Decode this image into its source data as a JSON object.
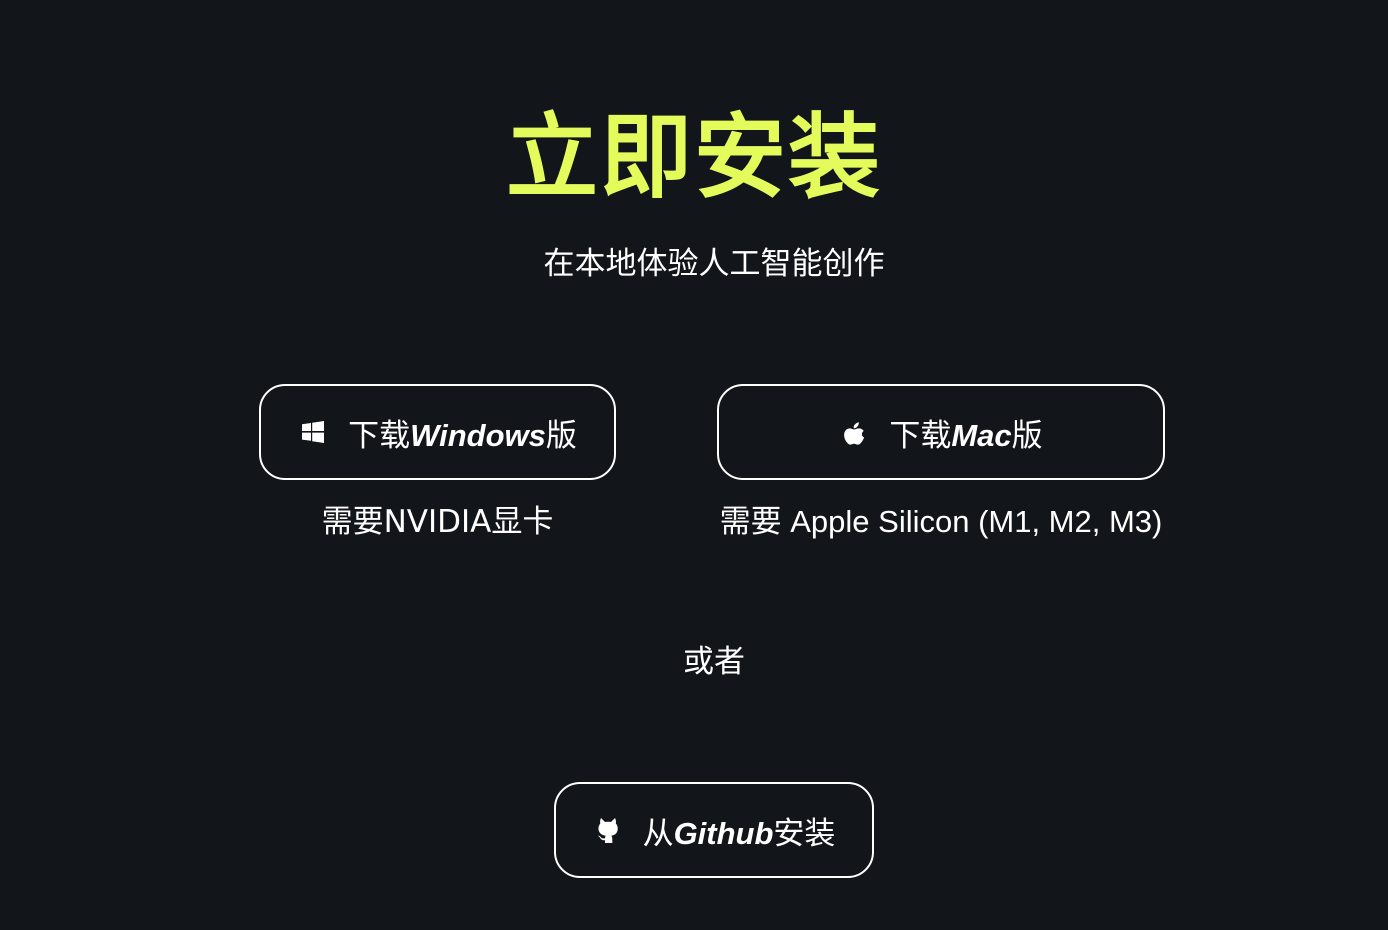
{
  "header": {
    "title": "立即安装",
    "subtitle": "在本地体验人工智能创作"
  },
  "downloads": {
    "windows": {
      "prefix": "下载",
      "brand": "Windows",
      "suffix": "版",
      "icon": "windows-icon",
      "requirement": "需要NVIDIA显卡"
    },
    "mac": {
      "prefix": "下载",
      "brand": "Mac",
      "suffix": "版",
      "icon": "apple-icon",
      "requirement": "需要 Apple Silicon (M1, M2, M3)"
    }
  },
  "separator": "或者",
  "github": {
    "prefix": "从",
    "brand": "Github",
    "suffix": "安装",
    "icon": "github-icon"
  },
  "colors": {
    "background": "#121519",
    "accent": "#e4fb5c",
    "text": "#ffffff"
  }
}
